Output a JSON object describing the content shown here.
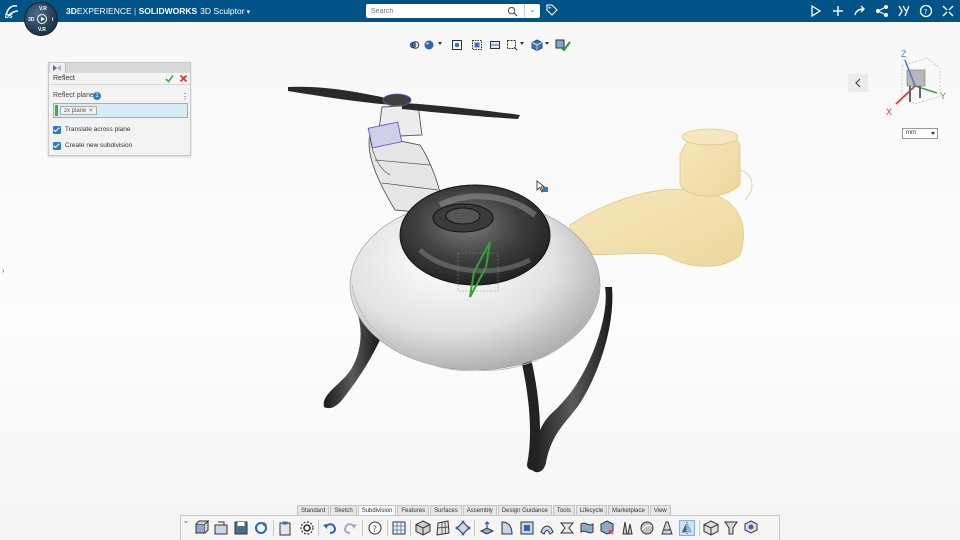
{
  "header": {
    "brand_3d": "3D",
    "brand_experience": "EXPERIENCE",
    "separator": " | ",
    "brand_app": "SOLIDWORKS",
    "role": "3D Sculptor",
    "search_placeholder": "Search",
    "compass_labels": {
      "top": "V.R",
      "left": "3D",
      "right": "i",
      "bottom": "V.R"
    }
  },
  "panel": {
    "title": "Reflect",
    "reflect_plane_label": "Reflect plane",
    "reflect_plane_count": "1",
    "selected_plane": "zx plane",
    "translate_label": "Translate across plane",
    "translate_checked": true,
    "new_subdivision_label": "Create new subdivision",
    "new_subdivision_checked": true
  },
  "units": {
    "selected": "mm"
  },
  "triad": {
    "x": "X",
    "y": "Y",
    "z": "Z"
  },
  "action_tabs": [
    {
      "label": "Standard",
      "active": false
    },
    {
      "label": "Sketch",
      "active": false
    },
    {
      "label": "Subdivision",
      "active": true
    },
    {
      "label": "Features",
      "active": false
    },
    {
      "label": "Surfaces",
      "active": false
    },
    {
      "label": "Assembly",
      "active": false
    },
    {
      "label": "Design Guidance",
      "active": false
    },
    {
      "label": "Tools",
      "active": false
    },
    {
      "label": "Lifecycle",
      "active": false
    },
    {
      "label": "Marketplace",
      "active": false
    },
    {
      "label": "View",
      "active": false
    }
  ],
  "colors": {
    "topbar": "#005386",
    "accent": "#2f7bc4",
    "ok": "#3bb13b",
    "cancel": "#d9322b",
    "model_body": "#efefef",
    "model_dark": "#3a3a3a",
    "reflected_ghost": "#f2dca0"
  }
}
